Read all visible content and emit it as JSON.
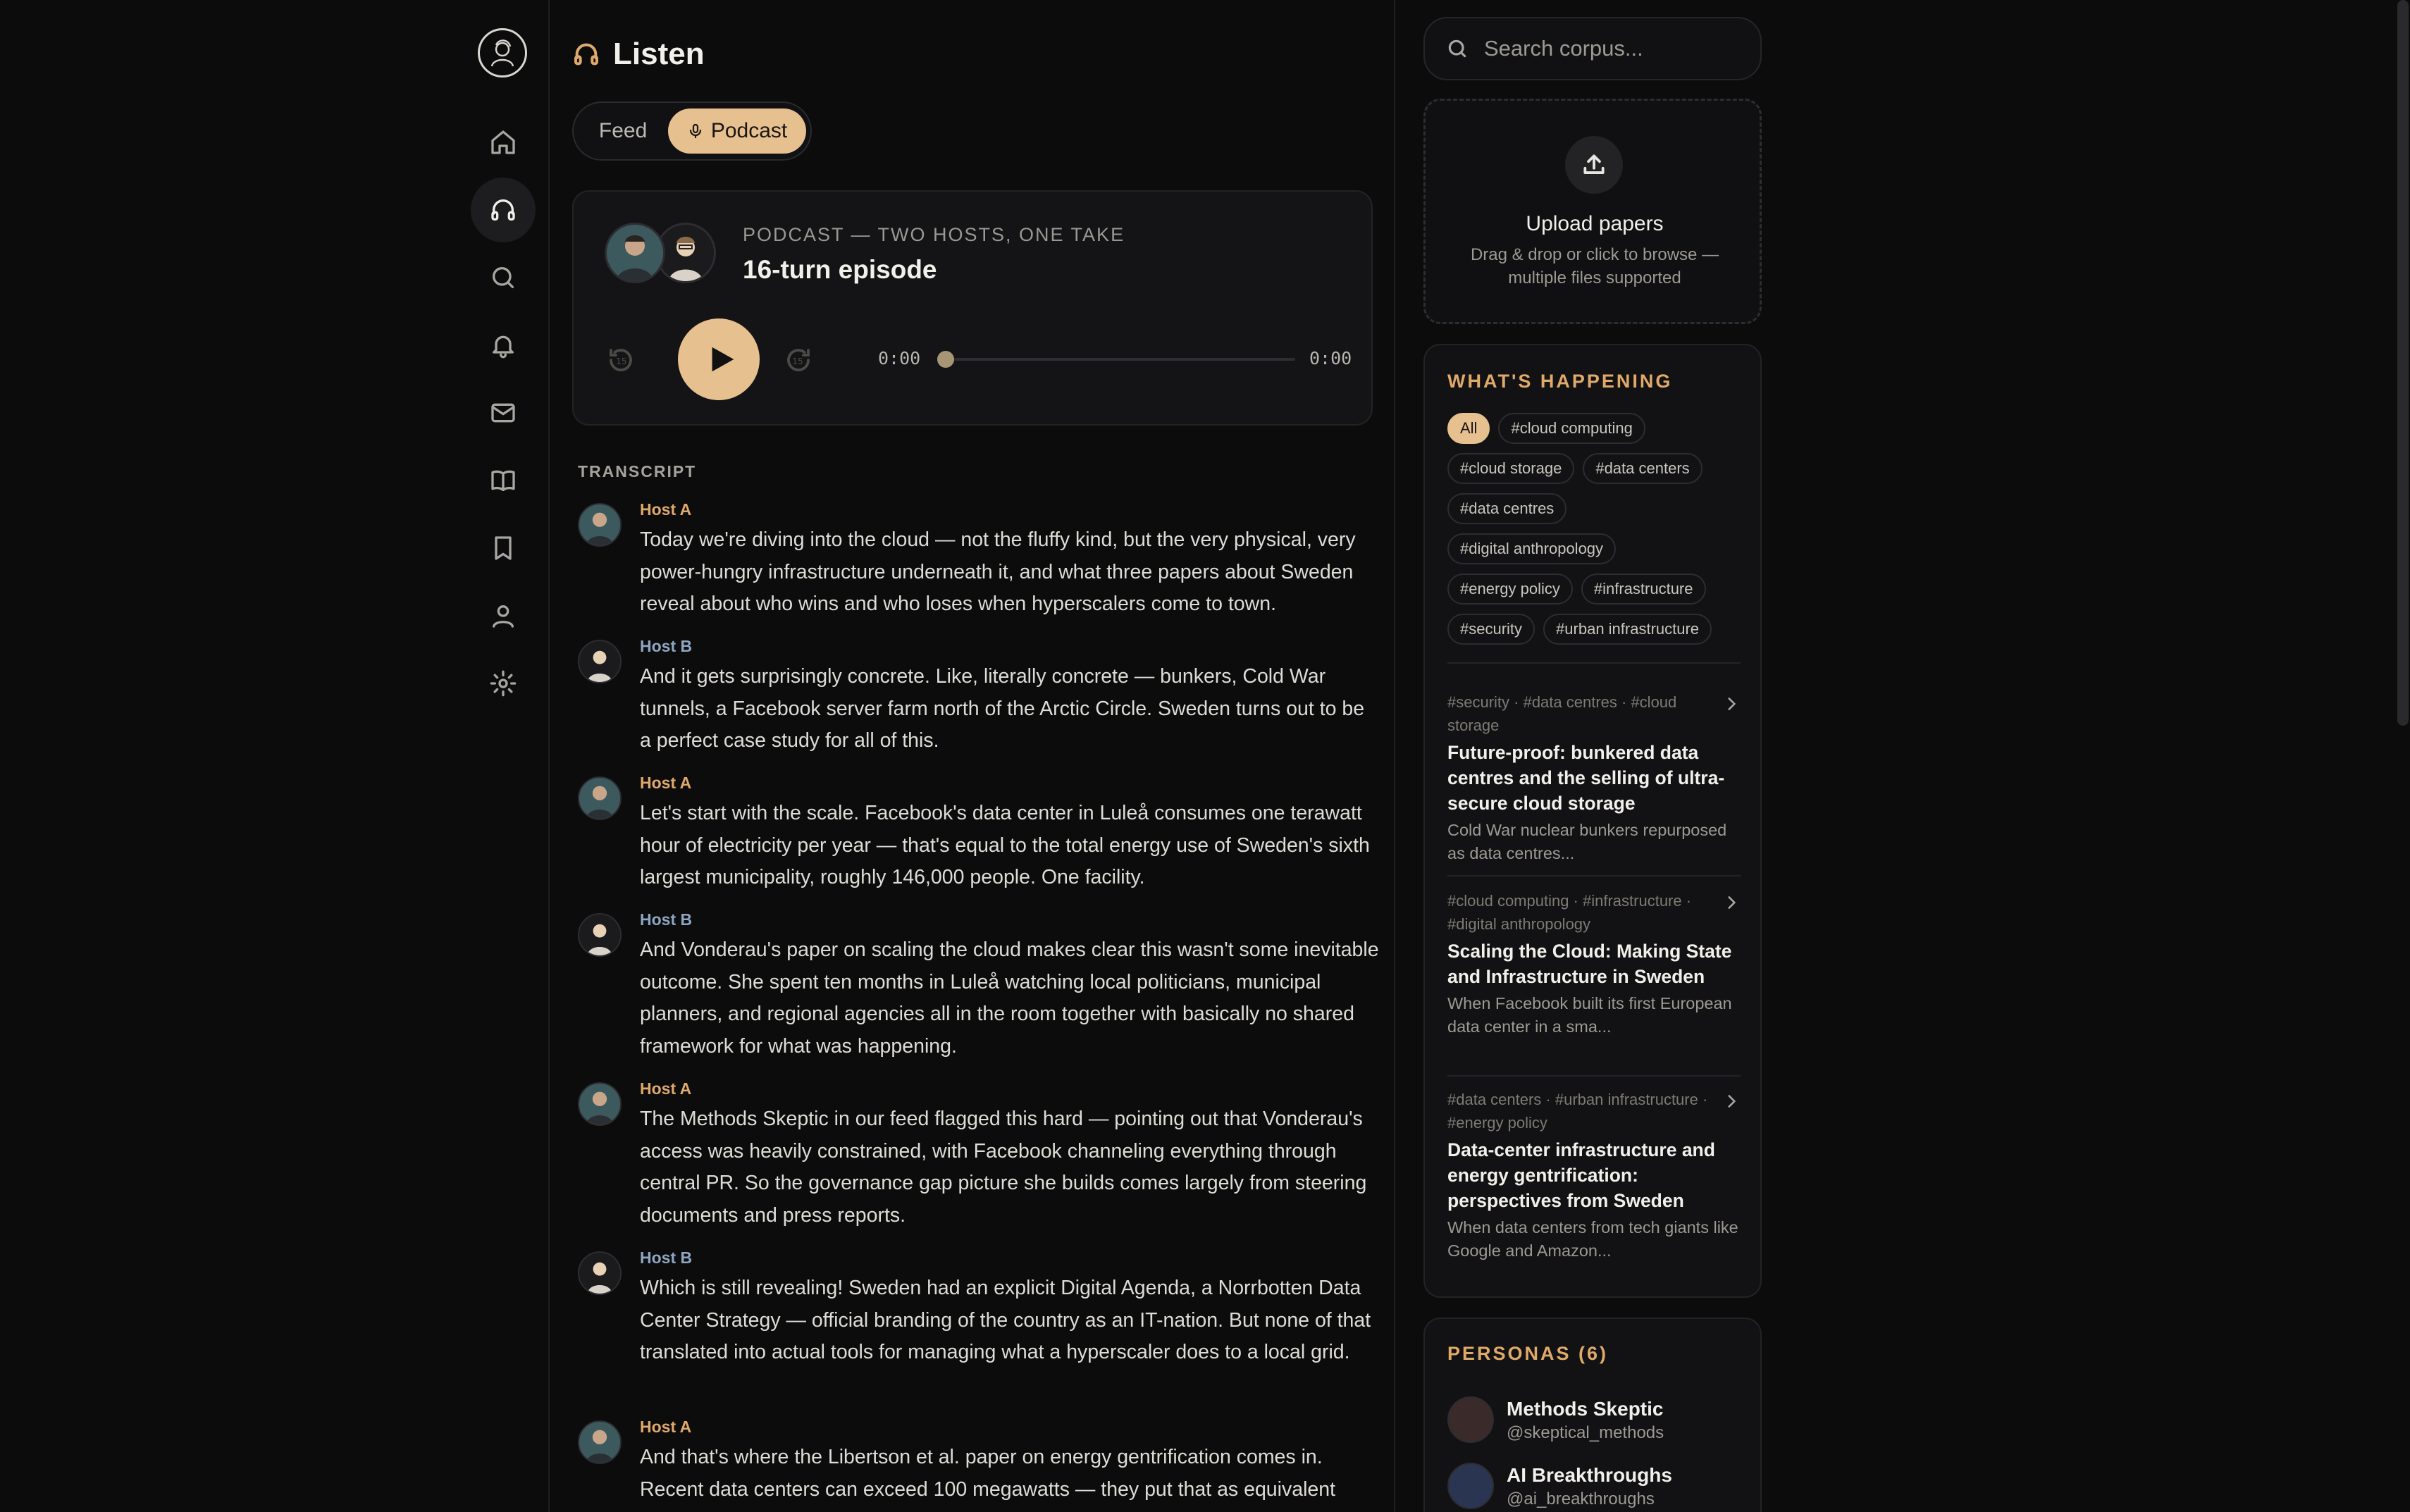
{
  "nav": {
    "items": [
      "home",
      "listen",
      "search",
      "notifications",
      "messages",
      "library",
      "bookmarks",
      "profile",
      "settings"
    ]
  },
  "page": {
    "title": "Listen"
  },
  "tabs": {
    "feed": "Feed",
    "podcast": "Podcast"
  },
  "podcast": {
    "label": "PODCAST — TWO HOSTS, ONE TAKE",
    "title": "16-turn episode",
    "time_current": "0:00",
    "time_total": "0:00",
    "progress": 0
  },
  "transcript": {
    "label": "TRANSCRIPT",
    "turns": [
      {
        "speaker": "Host A",
        "host": "a",
        "text": "Today we're diving into the cloud — not the fluffy kind, but the very physical, very power-hungry infrastructure underneath it, and what three papers about Sweden reveal about who wins and who loses when hyperscalers come to town."
      },
      {
        "speaker": "Host B",
        "host": "b",
        "text": "And it gets surprisingly concrete. Like, literally concrete — bunkers, Cold War tunnels, a Facebook server farm north of the Arctic Circle. Sweden turns out to be a perfect case study for all of this."
      },
      {
        "speaker": "Host A",
        "host": "a",
        "text": "Let's start with the scale. Facebook's data center in Luleå consumes one terawatt hour of electricity per year — that's equal to the total energy use of Sweden's sixth largest municipality, roughly 146,000 people. One facility."
      },
      {
        "speaker": "Host B",
        "host": "b",
        "text": "And Vonderau's paper on scaling the cloud makes clear this wasn't some inevitable outcome. She spent ten months in Luleå watching local politicians, municipal planners, and regional agencies all in the room together with basically no shared framework for what was happening."
      },
      {
        "speaker": "Host A",
        "host": "a",
        "text": "The Methods Skeptic in our feed flagged this hard — pointing out that Vonderau's access was heavily constrained, with Facebook channeling everything through central PR. So the governance gap picture she builds comes largely from steering documents and press reports."
      },
      {
        "speaker": "Host B",
        "host": "b",
        "text": "Which is still revealing! Sweden had an explicit Digital Agenda, a Norrbotten Data Center Strategy — official branding of the country as an IT-nation. But none of that translated into actual tools for managing what a hyperscaler does to a local grid."
      },
      {
        "speaker": "Host A",
        "host": "a",
        "text": "And that's where the Libertson et al. paper on energy gentrification comes in. Recent data centers can exceed 100 megawatts — they put that as equivalent"
      }
    ]
  },
  "search": {
    "placeholder": "Search corpus..."
  },
  "upload": {
    "title": "Upload papers",
    "description": "Drag & drop or click to browse — multiple files supported"
  },
  "happening": {
    "heading": "WHAT'S HAPPENING",
    "tag_rows": [
      [
        "All",
        "#cloud computing"
      ],
      [
        "#cloud storage",
        "#data centers"
      ],
      [
        "#data centres"
      ],
      [
        "#digital anthropology"
      ],
      [
        "#energy policy",
        "#infrastructure"
      ],
      [
        "#security",
        "#urban infrastructure"
      ]
    ],
    "stories": [
      {
        "tags": "#security · #data centres · #cloud storage",
        "title": "Future-proof: bunkered data centres and the selling of ultra-secure cloud storage",
        "desc": "Cold War nuclear bunkers repurposed as data centres..."
      },
      {
        "tags": "#cloud computing · #infrastructure · #digital anthropology",
        "title": "Scaling the Cloud: Making State and Infrastructure in Sweden",
        "desc": "When Facebook built its first European data center in a sma..."
      },
      {
        "tags": "#data centers · #urban infrastructure · #energy policy",
        "title": "Data-center infrastructure and energy gentrification: perspectives from Sweden",
        "desc": "When data centers from tech giants like Google and Amazon..."
      }
    ]
  },
  "personas": {
    "heading": "PERSONAS (6)",
    "items": [
      {
        "name": "Methods Skeptic",
        "handle": "@skeptical_methods",
        "color": "#3a2a2a"
      },
      {
        "name": "AI Breakthroughs",
        "handle": "@ai_breakthroughs",
        "color": "#2a3552"
      }
    ]
  }
}
